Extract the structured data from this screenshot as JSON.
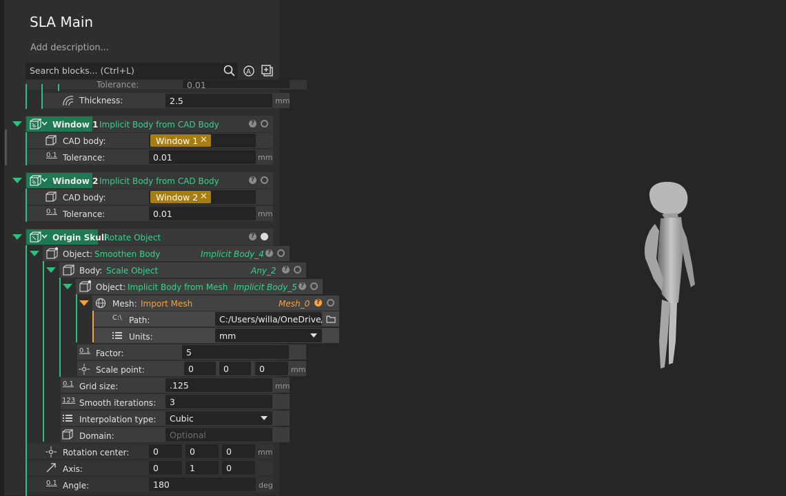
{
  "header": {
    "title": "SLA Main",
    "description": "Add description...",
    "search_placeholder": "Search blocks... (Ctrl+L)"
  },
  "partial_top": {
    "tolerance_label": "Tolerance:",
    "tolerance_value": "0.01",
    "thickness_label": "Thickness:",
    "thickness_value": "2.5",
    "unit": "mm"
  },
  "window1": {
    "name": "Window 1",
    "type": "Implicit Body from CAD Body",
    "cad_label": "CAD body:",
    "cad_chip": "Window 1",
    "tol_label": "Tolerance:",
    "tol_value": "0.01",
    "unit": "mm"
  },
  "window2": {
    "name": "Window 2",
    "type": "Implicit Body from CAD Body",
    "cad_label": "CAD body:",
    "cad_chip": "Window 2",
    "tol_label": "Tolerance:",
    "tol_value": "0.01",
    "unit": "mm"
  },
  "origin_skull": {
    "name": "Origin Skull",
    "type": "Rotate Object",
    "object_label": "Object:",
    "object_type": "Smoothen Body",
    "object_ref": "Implicit Body_4",
    "body_label": "Body:",
    "body_type": "Scale Object",
    "body_ref": "Any_2",
    "inner_object_label": "Object:",
    "inner_object_type": "Implicit Body from Mesh",
    "inner_object_ref": "Implicit Body_5",
    "mesh_label": "Mesh:",
    "mesh_type": "Import Mesh",
    "mesh_ref": "Mesh_0",
    "path_label": "Path:",
    "path_value": "C:/Users/willa/OneDrive/I",
    "units_label": "Units:",
    "units_value": "mm",
    "factor_label": "Factor:",
    "factor_value": "5",
    "scale_point_label": "Scale point:",
    "scale_point": [
      "0",
      "0",
      "0"
    ],
    "grid_label": "Grid size:",
    "grid_value": ".125",
    "smooth_label": "Smooth iterations:",
    "smooth_value": "3",
    "interp_label": "Interpolation type:",
    "interp_value": "Cubic",
    "domain_label": "Domain:",
    "domain_placeholder": "Optional",
    "rot_center_label": "Rotation center:",
    "rot_center": [
      "0",
      "0",
      "0"
    ],
    "axis_label": "Axis:",
    "axis": [
      "0",
      "1",
      "0"
    ],
    "angle_label": "Angle:",
    "angle_value": "180",
    "unit_mm": "mm",
    "unit_deg": "deg"
  },
  "colors": {
    "accent_green": "#2ec07c",
    "accent_orange": "#f4a340",
    "chip_gold": "#a77d12"
  }
}
